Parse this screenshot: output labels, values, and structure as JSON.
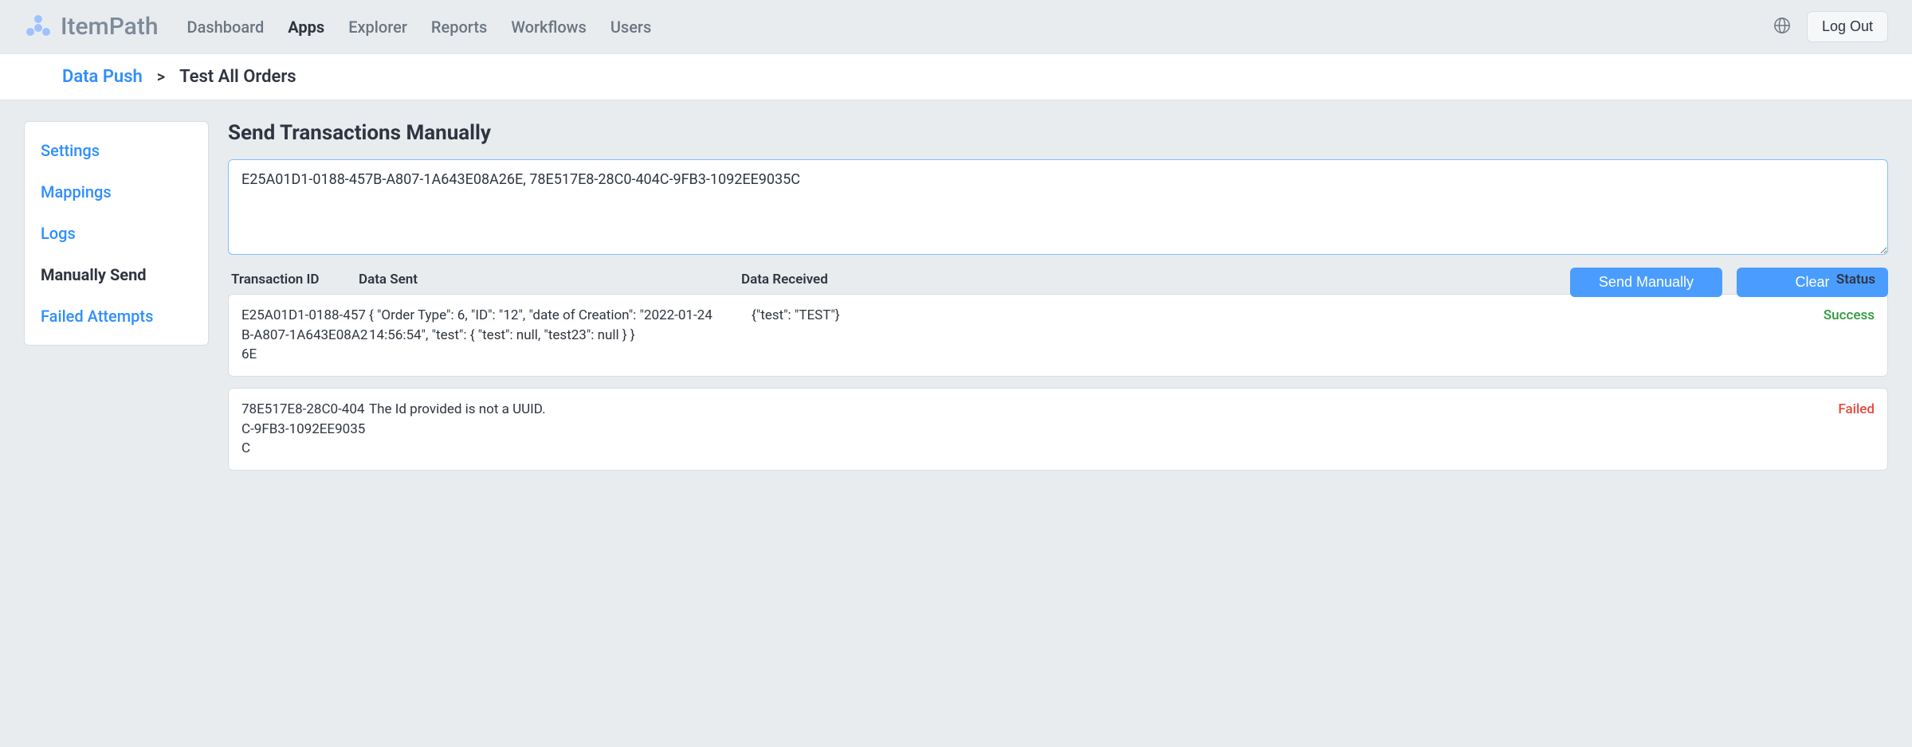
{
  "brand": "ItemPath",
  "nav": {
    "dashboard": "Dashboard",
    "apps": "Apps",
    "explorer": "Explorer",
    "reports": "Reports",
    "workflows": "Workflows",
    "users": "Users"
  },
  "logout": "Log Out",
  "breadcrumb": {
    "root": "Data Push",
    "sep": ">",
    "current": "Test All Orders"
  },
  "sidebar": {
    "settings": "Settings",
    "mappings": "Mappings",
    "logs": "Logs",
    "manually_send": "Manually Send",
    "failed_attempts": "Failed Attempts"
  },
  "page": {
    "title": "Send Transactions Manually",
    "textarea_value": "E25A01D1-0188-457B-A807-1A643E08A26E, 78E517E8-28C0-404C-9FB3-1092EE9035C",
    "send_btn": "Send Manually",
    "clear_btn": "Clear"
  },
  "table": {
    "col_txid": "Transaction ID",
    "col_sent": "Data Sent",
    "col_received": "Data Received",
    "col_status": "Status"
  },
  "rows": [
    {
      "txid": "E25A01D1-0188-457B-A807-1A643E08A26E",
      "sent": "{ \"Order Type\": 6, \"ID\": \"12\", \"date of Creation\": \"2022-01-24 14:56:54\", \"test\": { \"test\": null, \"test23\": null } }",
      "received": "{\"test\": \"TEST\"}",
      "status": "Success",
      "status_kind": "success"
    },
    {
      "txid": "78E517E8-28C0-404C-9FB3-1092EE9035C",
      "sent": "The Id provided is not a UUID.",
      "received": "",
      "status": "Failed",
      "status_kind": "failed"
    }
  ]
}
